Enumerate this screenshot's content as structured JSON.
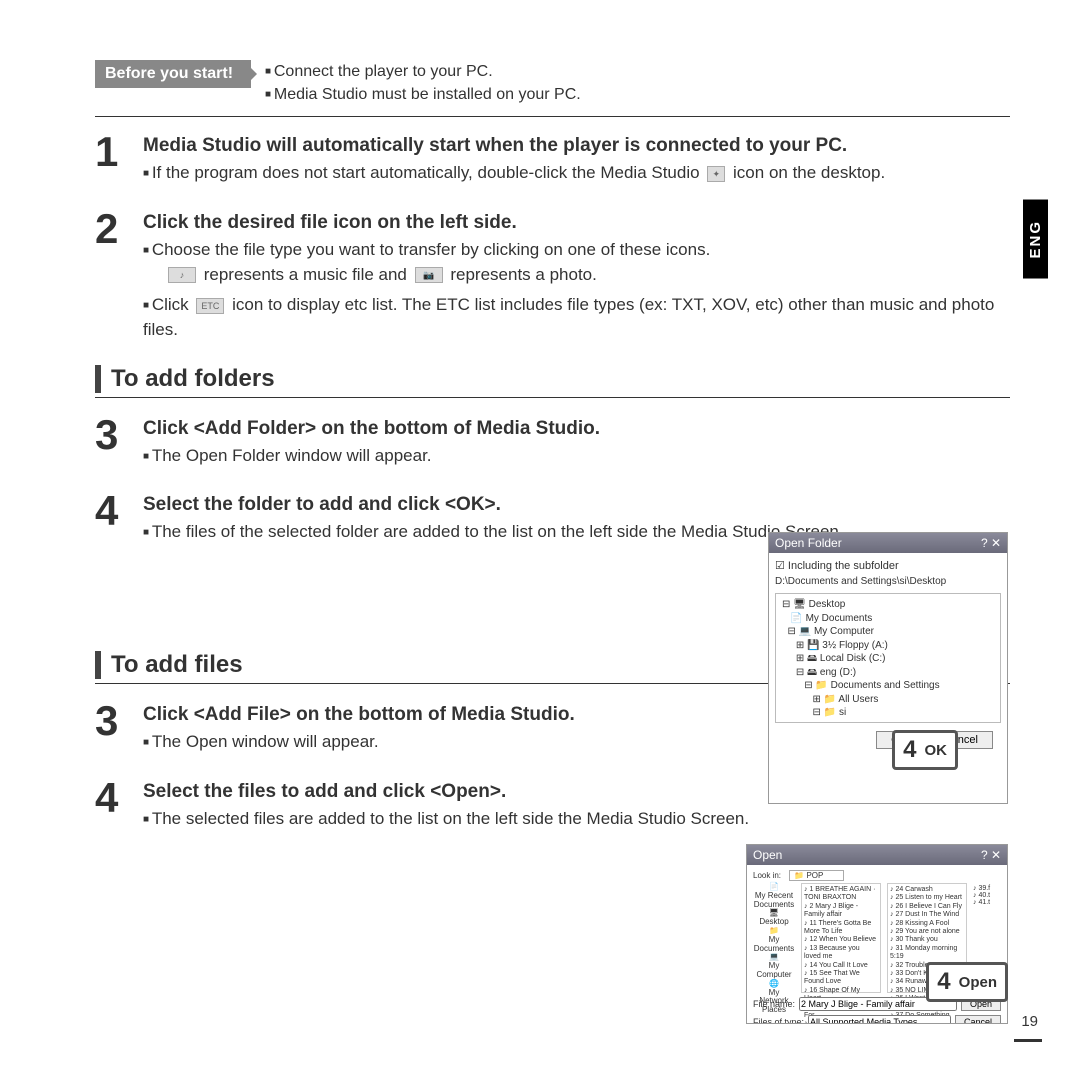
{
  "lang_tab": "ENG",
  "before": {
    "label": "Before you start!",
    "b1": "Connect the player to your PC.",
    "b2": "Media Studio must be installed on your PC."
  },
  "step1": {
    "num": "1",
    "title": "Media Studio will automatically start when the player is connected to your PC.",
    "b1a": "If the program does not start automatically, double-click the Media Studio ",
    "b1b": " icon on the desktop."
  },
  "step2": {
    "num": "2",
    "title": "Click the desired file icon on the left side.",
    "b1": "Choose the file type you want to transfer by clicking on one of these icons.",
    "note_a": " represents a music file and ",
    "note_b": " represents a photo.",
    "b2a": "Click ",
    "etc_label": "ETC",
    "b2b": " icon to display etc list. The ETC list includes file types (ex: TXT, XOV, etc) other than music and photo files."
  },
  "section_folders": "To add folders",
  "step3a": {
    "num": "3",
    "title": "Click <Add Folder> on the bottom of Media Studio.",
    "b1": "The Open Folder window will appear."
  },
  "step4a": {
    "num": "4",
    "title": "Select the folder to add and click  <OK>.",
    "b1": "The files of the selected folder are added to the list on the left side the Media Studio Screen."
  },
  "section_files": "To add files",
  "step3b": {
    "num": "3",
    "title": "Click <Add File> on the bottom of Media Studio.",
    "b1": "The Open window will appear."
  },
  "step4b": {
    "num": "4",
    "title": "Select the files to add and click <Open>.",
    "b1": "The selected files are added to the list on the left side the Media Studio Screen."
  },
  "fig1": {
    "title": "Open Folder",
    "check": "Including the subfolder",
    "path": "D:\\Documents and Settings\\si\\Desktop",
    "t0": "⊟ 🖥 Desktop",
    "t1": "   📄 My Documents",
    "t2": "  ⊟ 💻 My Computer",
    "t3": "     ⊞ 💾 3½ Floppy (A:)",
    "t4": "     ⊞ 🖴 Local Disk (C:)",
    "t5": "     ⊟ 🖴 eng (D:)",
    "t6": "        ⊟ 📁 Documents and Settings",
    "t7": "           ⊞ 📁 All Users",
    "t8": "           ⊟ 📁 si",
    "ok": "OK",
    "cancel": "Cancel"
  },
  "callout1": {
    "num": "4",
    "label": "OK"
  },
  "fig2": {
    "title": "Open",
    "lookin": "Look in:",
    "folder": "POP",
    "side1": "My Recent Documents",
    "side2": "Desktop",
    "side3": "My Documents",
    "side4": "My Computer",
    "side5": "My Network Places",
    "fname_l": "File name:",
    "fname_v": "2 Mary J Blige - Family affair",
    "ftype_l": "Files of type:",
    "ftype_v": "All Supported Media Types",
    "open": "Open",
    "cancel": "Cancel"
  },
  "callout2": {
    "num": "4",
    "label": "Open"
  },
  "page_number": "19"
}
